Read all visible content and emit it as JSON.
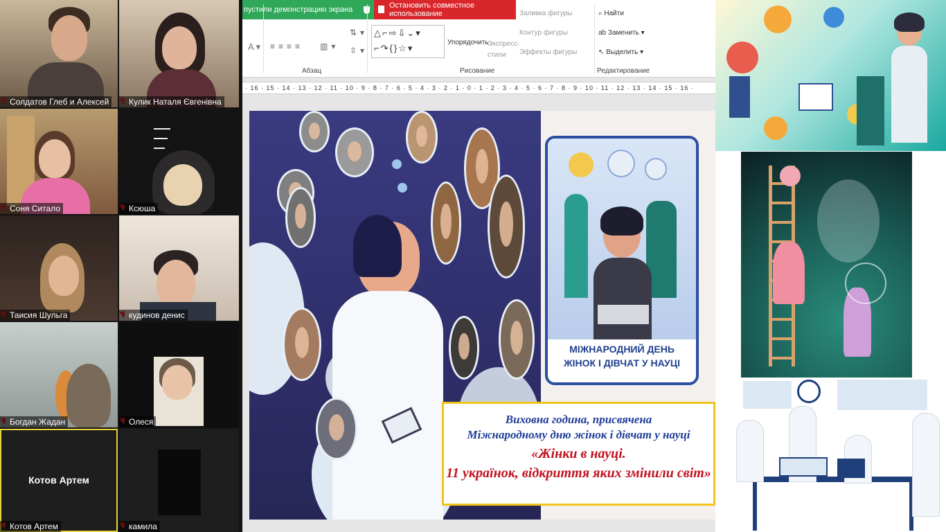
{
  "share_bar": {
    "sharing_label": "пустили демонстрацию экрана",
    "stop_label": "Остановить совместное использование"
  },
  "participants": [
    {
      "name": "Солдатов Глеб и Алексей"
    },
    {
      "name": "Кулик Наталя Євгенівна"
    },
    {
      "name": "Соня Ситало"
    },
    {
      "name": "Ксюша"
    },
    {
      "name": "Таисия Шульга"
    },
    {
      "name": "кудинов денис"
    },
    {
      "name": "Богдан Жадан"
    },
    {
      "name": "Олеся"
    },
    {
      "name": "Котов Артем",
      "display_name": "Котов Артем"
    },
    {
      "name": "камила"
    }
  ],
  "ribbon": {
    "groups": {
      "paragraph": "Абзац",
      "drawing": "Рисование",
      "editing": "Редактирование"
    },
    "arrange": "Упорядочить",
    "quick_styles": "Экспресс-\nстили",
    "shape_fill": "Заливка фигуры",
    "shape_outline": "Контур фигуры",
    "shape_effects": "Эффекты фигуры",
    "find": "Найти",
    "replace": "Заменить",
    "select": "Выделить",
    "ruler": "· 16 · 15 · 14 · 13 · 12 · 11 · 10 · 9 · 8 · 7 · 6 · 5 · 4 · 3 · 2 · 1 · 0 · 1 · 2 · 3 · 4 · 5 · 6 · 7 · 8 · 9 · 10 · 11 · 12 · 13 · 14 · 15 · 16 ·"
  },
  "slide": {
    "poster_title_line1": "МІЖНАРОДНИЙ ДЕНЬ",
    "poster_title_line2": "ЖІНОК І ДІВЧАТ У НАУЦІ",
    "caption_line1": "Виховна година, присвячена",
    "caption_line2": "Міжнародному дню жінок і дівчат у науці",
    "caption_line3": "«Жінки в науці.",
    "caption_line4": "11 українок, відкриття яких змінили світ»"
  },
  "colors": {
    "share_green": "#2fa85a",
    "share_red": "#d9262a",
    "caption_blue": "#1f3d9a",
    "caption_red": "#c1121f",
    "caption_border": "#f0c419",
    "slide_bg": "#2b2a63"
  }
}
